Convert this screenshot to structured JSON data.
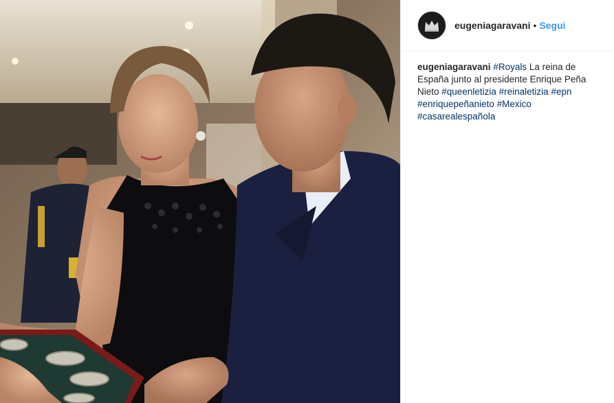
{
  "post": {
    "username": "eugeniagaravani",
    "separator": "•",
    "follow_label": "Segui",
    "avatar_icon": "crown-avatar-icon",
    "colors": {
      "follow": "#3897f0",
      "hashtag": "#003569",
      "text": "#262626",
      "divider": "#efefef"
    }
  },
  "caption": {
    "username": "eugeniagaravani",
    "segments": [
      {
        "type": "tag",
        "text": "#Royals"
      },
      {
        "type": "text",
        "text": " La reina de España junto al presidente Enrique Peña Nieto "
      },
      {
        "type": "tag",
        "text": "#queenletizia"
      },
      {
        "type": "text",
        "text": " "
      },
      {
        "type": "tag",
        "text": "#reinaletizia"
      },
      {
        "type": "text",
        "text": " "
      },
      {
        "type": "tag",
        "text": "#epn"
      },
      {
        "type": "text",
        "text": " "
      },
      {
        "type": "tag",
        "text": "#enriquepeñanieto"
      },
      {
        "type": "text",
        "text": " "
      },
      {
        "type": "tag",
        "text": "#Mexico"
      },
      {
        "type": "text",
        "text": " "
      },
      {
        "type": "tag",
        "text": "#casarealespañola"
      }
    ]
  }
}
